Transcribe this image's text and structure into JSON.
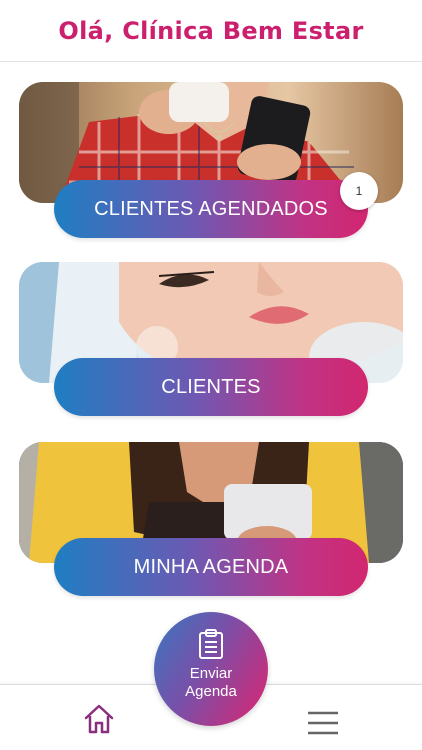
{
  "header": {
    "title": "Olá, Clínica Bem Estar"
  },
  "cards": [
    {
      "label": "CLIENTES AGENDADOS",
      "badge": "1",
      "image": "woman-coffee-phone-photo"
    },
    {
      "label": "CLIENTES",
      "image": "facial-treatment-photo"
    },
    {
      "label": "MINHA AGENDA",
      "image": "woman-phone-photo"
    }
  ],
  "fab": {
    "label": "Enviar Agenda",
    "icon": "clipboard-icon"
  },
  "bottom_nav": {
    "home_icon": "home-icon",
    "menu_icon": "hamburger-menu-icon"
  },
  "colors": {
    "brand": "#cc1f6e",
    "gradient_start": "#1f7ec3",
    "gradient_end": "#d2266f",
    "nav_icon": "#8a2f7e"
  }
}
